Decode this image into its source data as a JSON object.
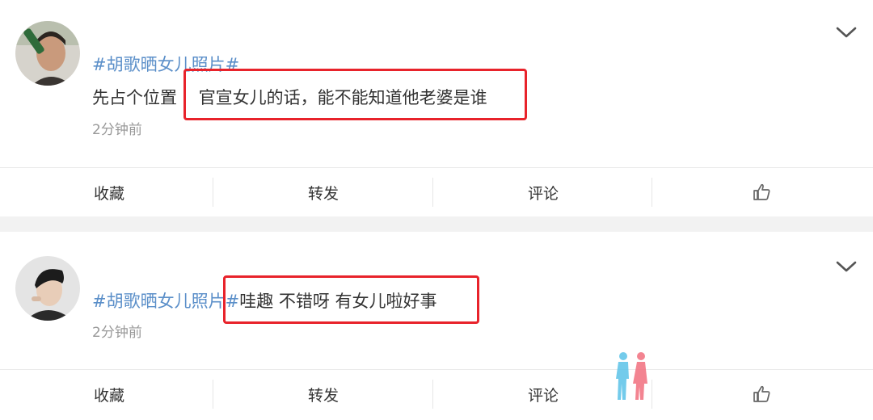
{
  "posts": [
    {
      "hashtag": "#胡歌晒女儿照片#",
      "text_before": "先占个位置",
      "text_highlight": "官宣女儿的话，能不能知道他老婆是谁",
      "time": "2分钟前",
      "icons": {
        "avatar": "user-avatar-icon",
        "menu": "chevron-down-icon"
      }
    },
    {
      "hashtag": "#胡歌晒女儿照片#",
      "text_highlight": "哇趣 不错呀 有女儿啦好事",
      "time": "2分钟前",
      "icons": {
        "avatar": "user-avatar-icon",
        "menu": "chevron-down-icon"
      }
    }
  ],
  "actions": {
    "favorite": "收藏",
    "repost": "转发",
    "comment": "评论",
    "like_icon": "thumbs-up-icon"
  },
  "colors": {
    "hashtag": "#5b8fc9",
    "highlight_box": "#e8232b",
    "timestamp": "#999999",
    "divider": "#f2f2f2"
  }
}
